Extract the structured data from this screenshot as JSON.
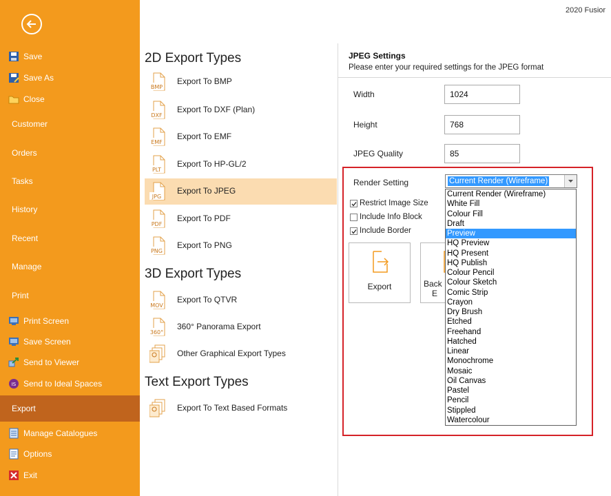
{
  "header": {
    "app_title_partial": "2020 Fusior"
  },
  "sidebar": {
    "items": [
      {
        "label": "Save",
        "icon": "save-icon"
      },
      {
        "label": "Save As",
        "icon": "save-as-icon"
      },
      {
        "label": "Close",
        "icon": "close-folder-icon"
      },
      {
        "label": "Customer"
      },
      {
        "label": "Orders"
      },
      {
        "label": "Tasks"
      },
      {
        "label": "History"
      },
      {
        "label": "Recent"
      },
      {
        "label": "Manage"
      },
      {
        "label": "Print"
      },
      {
        "label": "Print Screen",
        "icon": "print-screen-icon"
      },
      {
        "label": "Save Screen",
        "icon": "save-screen-icon"
      },
      {
        "label": "Send to Viewer",
        "icon": "send-to-viewer-icon"
      },
      {
        "label": "Send to Ideal Spaces",
        "icon": "ideal-spaces-icon"
      },
      {
        "label": "Export",
        "active": true
      },
      {
        "label": "Manage Catalogues",
        "icon": "catalogue-icon"
      },
      {
        "label": "Options",
        "icon": "options-icon"
      },
      {
        "label": "Exit",
        "icon": "exit-icon"
      }
    ]
  },
  "export_types": {
    "section_2d": "2D Export Types",
    "section_3d": "3D Export Types",
    "section_text": "Text Export Types",
    "items_2d": [
      {
        "tag": "BMP",
        "label": "Export To BMP"
      },
      {
        "tag": "DXF",
        "label": "Export To DXF (Plan)"
      },
      {
        "tag": "EMF",
        "label": "Export To EMF"
      },
      {
        "tag": "PLT",
        "label": "Export To HP-GL/2"
      },
      {
        "tag": "JPG",
        "label": "Export To JPEG",
        "selected": true
      },
      {
        "tag": "PDF",
        "label": "Export To PDF"
      },
      {
        "tag": "PNG",
        "label": "Export To PNG"
      }
    ],
    "items_3d": [
      {
        "tag": "MOV",
        "label": "Export To QTVR"
      },
      {
        "tag": "360°",
        "label": "360° Panorama Export"
      },
      {
        "label": "Other Graphical Export Types"
      }
    ],
    "items_text": [
      {
        "label": "Export To Text Based Formats"
      }
    ]
  },
  "settings": {
    "title": "JPEG Settings",
    "subtitle": "Please enter your required settings for the JPEG format",
    "width_label": "Width",
    "width_value": "1024",
    "height_label": "Height",
    "height_value": "768",
    "quality_label": "JPEG Quality",
    "quality_value": "85",
    "render_label": "Render Setting",
    "render_value": "Current Render (Wireframe)",
    "restrict_label": "Restrict Image Size",
    "restrict_checked": true,
    "info_block_label": "Include Info Block",
    "info_block_checked": false,
    "border_label": "Include Border",
    "border_checked": true,
    "export_button": "Export",
    "back_button_partial_1": "Back",
    "back_button_partial_2": "E"
  },
  "render_options": [
    "Current Render (Wireframe)",
    "White Fill",
    "Colour Fill",
    "Draft",
    "Preview",
    "HQ Preview",
    "HQ Present",
    "HQ Publish",
    "Colour Pencil",
    "Colour Sketch",
    "Comic Strip",
    "Crayon",
    "Dry Brush",
    "Etched",
    "Freehand",
    "Hatched",
    "Linear",
    "Monochrome",
    "Mosaic",
    "Oil Canvas",
    "Pastel",
    "Pencil",
    "Stippled",
    "Watercolour"
  ],
  "render_highlighted": "Preview",
  "colors": {
    "sidebar": "#f39a1d",
    "sidebar_active": "#c0641d",
    "selected_row": "#fbdcb1",
    "highlight": "#3399ff",
    "annotation_box": "#d52127"
  }
}
